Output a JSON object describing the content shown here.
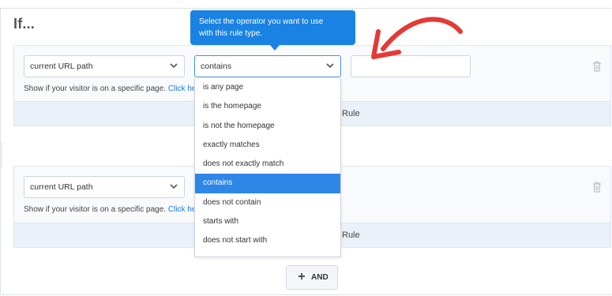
{
  "heading": "If...",
  "tooltip": {
    "line1": "Select the operator you want to use",
    "line2": "with this rule type."
  },
  "rules": [
    {
      "type_value": "current URL path",
      "operator_value": "contains",
      "help_text": "Show if your visitor is on a specific page.",
      "help_link": "Click her",
      "bar_label": "Rule"
    },
    {
      "type_value": "current URL path",
      "help_text": "Show if your visitor is on a specific page.",
      "help_link": "Click her",
      "bar_label": "Rule"
    }
  ],
  "operator_options": [
    "is any page",
    "is the homepage",
    "is not the homepage",
    "exactly matches",
    "does not exactly match",
    "contains",
    "does not contain",
    "starts with",
    "does not start with"
  ],
  "selected_operator": "contains",
  "and_button": "AND",
  "colors": {
    "accent": "#1a82e2",
    "annotation_arrow": "#e53935"
  }
}
